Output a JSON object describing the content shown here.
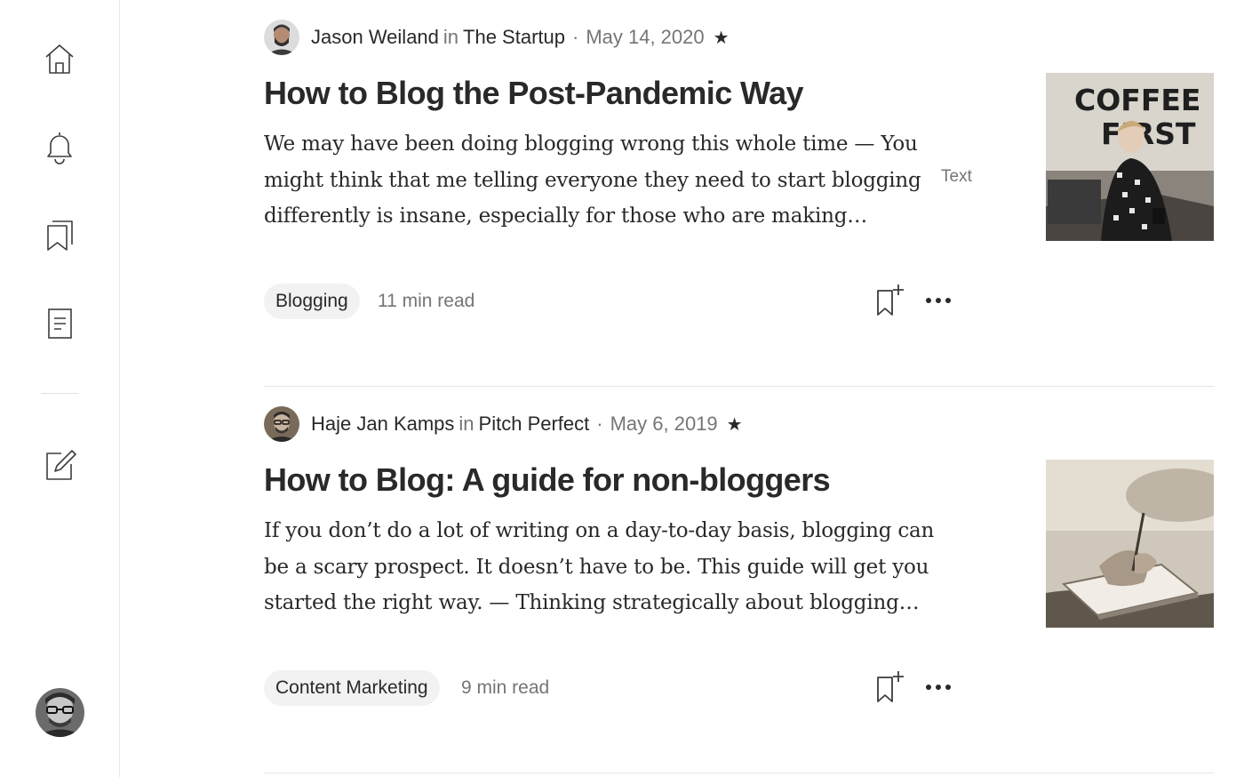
{
  "sidebar": {
    "items": [
      {
        "name": "home",
        "icon": "home-icon"
      },
      {
        "name": "notifications",
        "icon": "bell-icon"
      },
      {
        "name": "lists",
        "icon": "bookmarks-icon"
      },
      {
        "name": "stories",
        "icon": "document-icon"
      },
      {
        "name": "write",
        "icon": "pencil-square-icon"
      }
    ],
    "avatar_icon": "user-avatar"
  },
  "articles": [
    {
      "author": "Jason Weiland",
      "in": "in",
      "publication": "The Startup",
      "separator": "·",
      "date": "May 14, 2020",
      "star": "★",
      "title": "How to Blog the Post-Pandemic Way",
      "excerpt": "We may have been doing blogging wrong this whole time — You might think that me telling everyone they need to start blogging differently is insane, especially for those who are making…",
      "label": "Text",
      "tag": "Blogging",
      "read_time": "11 min read",
      "thumbnail_text": [
        "COFFEE",
        "FIRST"
      ]
    },
    {
      "author": "Haje Jan Kamps",
      "in": "in",
      "publication": "Pitch Perfect",
      "separator": "·",
      "date": "May 6, 2019",
      "star": "★",
      "title": "How to Blog: A guide for non-bloggers",
      "excerpt": "If you don’t do a lot of writing on a day-to-day basis, blogging can be a scary prospect. It doesn’t have to be. This guide will get you started the right way. — Thinking strategically about blogging…",
      "tag": "Content Marketing",
      "read_time": "9 min read"
    }
  ],
  "colors": {
    "text": "#292929",
    "muted": "#757575",
    "tag_bg": "#f2f2f2",
    "divider": "#e6e6e6"
  }
}
